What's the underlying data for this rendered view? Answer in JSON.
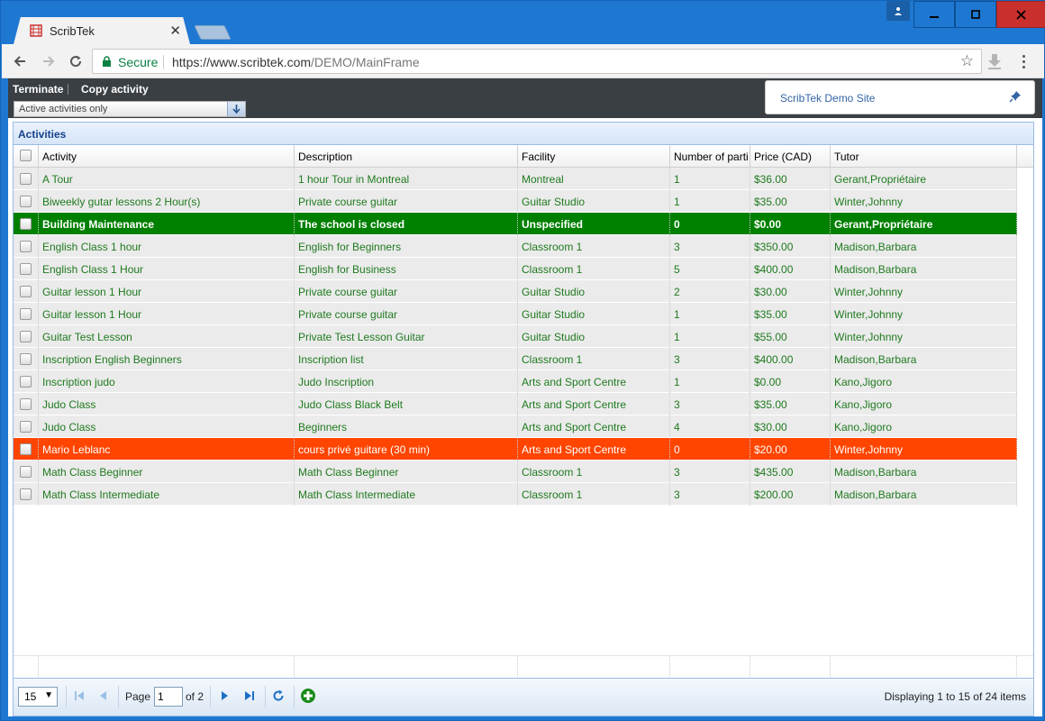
{
  "browser": {
    "tab_title": "ScribTek",
    "secure_label": "Secure",
    "url_host": "https://www.scribtek.com",
    "url_path": "/DEMO/MainFrame"
  },
  "app": {
    "actions": {
      "terminate": "Terminate",
      "copy": "Copy activity"
    },
    "filter": {
      "selected": "Active activities only"
    },
    "site_title": "ScribTek Demo Site"
  },
  "panel": {
    "title": "Activities",
    "columns": [
      "Activity",
      "Description",
      "Facility",
      "Number of parti",
      "Price (CAD)",
      "Tutor"
    ],
    "rows": [
      {
        "activity": "A Tour",
        "description": "1 hour Tour in Montreal",
        "facility": "Montreal",
        "number": "1",
        "price": "$36.00",
        "tutor": "Gerant,Propriétaire",
        "state": "normal"
      },
      {
        "activity": "Biweekly gutar lessons 2 Hour(s)",
        "description": "Private course guitar",
        "facility": "Guitar Studio",
        "number": "1",
        "price": "$35.00",
        "tutor": "Winter,Johnny",
        "state": "normal"
      },
      {
        "activity": "Building Maintenance",
        "description": "The school is closed",
        "facility": "Unspecified",
        "number": "0",
        "price": "$0.00",
        "tutor": "Gerant,Propriétaire",
        "state": "green"
      },
      {
        "activity": "English Class 1 hour",
        "description": "English for Beginners",
        "facility": "Classroom 1",
        "number": "3",
        "price": "$350.00",
        "tutor": "Madison,Barbara",
        "state": "normal"
      },
      {
        "activity": "English Class 1 Hour",
        "description": "English for Business",
        "facility": "Classroom 1",
        "number": "5",
        "price": "$400.00",
        "tutor": "Madison,Barbara",
        "state": "normal"
      },
      {
        "activity": "Guitar lesson 1 Hour",
        "description": "Private course guitar",
        "facility": "Guitar Studio",
        "number": "2",
        "price": "$30.00",
        "tutor": "Winter,Johnny",
        "state": "normal"
      },
      {
        "activity": "Guitar lesson 1 Hour",
        "description": "Private course guitar",
        "facility": "Guitar Studio",
        "number": "1",
        "price": "$35.00",
        "tutor": "Winter,Johnny",
        "state": "normal"
      },
      {
        "activity": "Guitar Test Lesson",
        "description": "Private Test Lesson Guitar",
        "facility": "Guitar Studio",
        "number": "1",
        "price": "$55.00",
        "tutor": "Winter,Johnny",
        "state": "normal"
      },
      {
        "activity": "Inscription English Beginners",
        "description": "Inscription list",
        "facility": "Classroom 1",
        "number": "3",
        "price": "$400.00",
        "tutor": "Madison,Barbara",
        "state": "normal"
      },
      {
        "activity": "Inscription judo",
        "description": "Judo Inscription",
        "facility": "Arts and Sport Centre",
        "number": "1",
        "price": "$0.00",
        "tutor": "Kano,Jigoro",
        "state": "normal"
      },
      {
        "activity": "Judo Class",
        "description": "Judo Class Black Belt",
        "facility": "Arts and Sport Centre",
        "number": "3",
        "price": "$35.00",
        "tutor": "Kano,Jigoro",
        "state": "normal"
      },
      {
        "activity": "Judo Class",
        "description": "Beginners",
        "facility": "Arts and Sport Centre",
        "number": "4",
        "price": "$30.00",
        "tutor": "Kano,Jigoro",
        "state": "normal"
      },
      {
        "activity": "Mario Leblanc",
        "description": "cours privé guitare (30 min)",
        "facility": "Arts and Sport Centre",
        "number": "0",
        "price": "$20.00",
        "tutor": "Winter,Johnny",
        "state": "orange"
      },
      {
        "activity": "Math Class Beginner",
        "description": "Math Class Beginner",
        "facility": "Classroom 1",
        "number": "3",
        "price": "$435.00",
        "tutor": "Madison,Barbara",
        "state": "normal"
      },
      {
        "activity": "Math Class Intermediate",
        "description": "Math Class Intermediate",
        "facility": "Classroom 1",
        "number": "3",
        "price": "$200.00",
        "tutor": "Madison,Barbara",
        "state": "normal"
      }
    ]
  },
  "pager": {
    "page_size": "15",
    "page_label": "Page",
    "page_value": "1",
    "of_label": "of 2",
    "info": "Displaying 1 to 15 of 24 items"
  },
  "colors": {
    "green_row": "#008000",
    "orange_row": "#ff4500",
    "text_green": "#1f7a1f"
  }
}
